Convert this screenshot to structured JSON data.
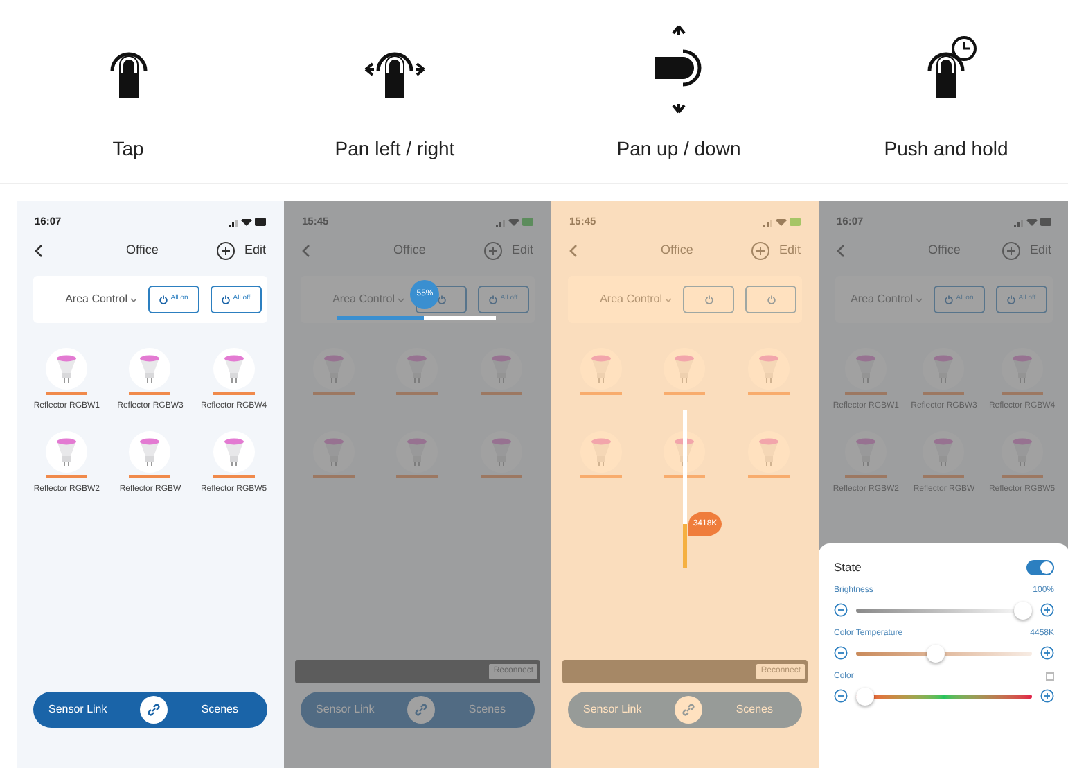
{
  "gestures": [
    {
      "label": "Tap",
      "kind": "tap"
    },
    {
      "label": "Pan left / right",
      "kind": "pan_horizontal"
    },
    {
      "label": "Pan up / down",
      "kind": "pan_vertical"
    },
    {
      "label": "Push and hold",
      "kind": "hold"
    }
  ],
  "phones": [
    {
      "time": "16:07",
      "charging": false,
      "title": "Office",
      "edit": "Edit",
      "area_control": "Area Control",
      "all_on": "All on",
      "all_off": "All off",
      "kind": "plain",
      "devices": [
        {
          "kind": "bulb",
          "name": "Reflector RGBW1"
        },
        {
          "kind": "bulb",
          "name": "Reflector RGBW3"
        },
        {
          "kind": "bulb",
          "name": "Reflector RGBW4"
        },
        {
          "kind": "bulb",
          "name": "Reflector RGBW2"
        },
        {
          "kind": "bulb",
          "name": "Reflector RGBW"
        },
        {
          "kind": "bulb",
          "name": "Reflector RGBW5"
        }
      ],
      "bottom_bar": {
        "left": "Sensor Link",
        "right": "Scenes"
      }
    },
    {
      "time": "15:45",
      "charging": true,
      "title": "Office",
      "edit": "Edit",
      "area_control": "Area Control",
      "all_off": "All off",
      "kind": "gray_overlay",
      "devices": [
        {
          "kind": "bulb"
        },
        {
          "kind": "bulb"
        },
        {
          "kind": "bulb"
        },
        {
          "kind": "bulb"
        },
        {
          "kind": "bulb"
        },
        {
          "kind": "bulb"
        }
      ],
      "snackbar": {
        "action": "Reconnect"
      },
      "bottom_bar": {
        "left": "Sensor Link",
        "right": "Scenes"
      },
      "popup": {
        "kind": "horizontal",
        "reading": "55%",
        "level": 0.55
      }
    },
    {
      "time": "15:45",
      "charging": true,
      "title": "Office",
      "edit": "Edit",
      "area_control": "Area Control",
      "kind": "orange_overlay",
      "devices": [
        {
          "kind": "bulb"
        },
        {
          "kind": "bulb"
        },
        {
          "kind": "bulb"
        },
        {
          "kind": "bulb"
        },
        {
          "kind": "bulb"
        },
        {
          "kind": "bulb"
        }
      ],
      "snackbar": {
        "action": "Reconnect"
      },
      "bottom_bar": {
        "left": "Sensor Link",
        "right": "Scenes"
      },
      "popup": {
        "kind": "vertical",
        "reading": "3418K",
        "level": 0.28
      }
    },
    {
      "time": "16:07",
      "charging": false,
      "title": "Office",
      "edit": "Edit",
      "area_control": "Area Control",
      "all_on": "All on",
      "all_off": "All off",
      "kind": "gray_overlay",
      "devices": [
        {
          "kind": "bulb",
          "name": "Reflector RGBW1"
        },
        {
          "kind": "bulb",
          "name": "Reflector RGBW3"
        },
        {
          "kind": "bulb",
          "name": "Reflector RGBW4"
        },
        {
          "kind": "bulb",
          "name": "Reflector RGBW2"
        },
        {
          "kind": "bulb",
          "name": "Reflector RGBW"
        },
        {
          "kind": "bulb",
          "name": "Reflector RGBW5"
        }
      ],
      "sheet": {
        "state_label": "State",
        "state_on": true,
        "sliders": [
          {
            "kind": "brightness",
            "label": "Brightness",
            "reading": "100%",
            "level": 1
          },
          {
            "kind": "temperature",
            "label": "Color Temperature",
            "reading": "4458K",
            "level": 0.45
          },
          {
            "kind": "color",
            "label": "Color",
            "checked": false,
            "level": 0
          }
        ]
      }
    }
  ]
}
